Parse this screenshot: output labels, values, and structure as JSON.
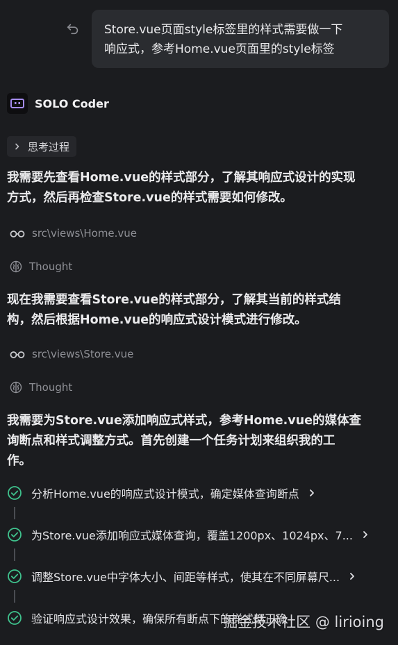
{
  "user_message": {
    "line1": "Store.vue页面style标签里的样式需要做一下",
    "line2": "响应式，参考Home.vue页面里的style标签"
  },
  "agent": {
    "name": "SOLO Coder"
  },
  "thinking": {
    "label": "思考过程"
  },
  "messages": [
    {
      "line1": "我需要先查看Home.vue的样式部分，了解其响应式设计的实现",
      "line2": "方式，然后再检查Store.vue的样式需要如何修改。"
    },
    {
      "line1": "现在我需要查看Store.vue的样式部分，了解其当前的样式结",
      "line2": "构，然后根据Home.vue的响应式设计模式进行修改。"
    },
    {
      "line1": "我需要为Store.vue添加响应式样式，参考Home.vue的媒体查",
      "line2": "询断点和样式调整方式。首先创建一个任务计划来组织我的工",
      "line3": "作。"
    }
  ],
  "file_reads": [
    "src\\views\\Home.vue",
    "src\\views\\Store.vue"
  ],
  "thought_label": "Thought",
  "tasks": [
    "分析Home.vue的响应式设计模式，确定媒体查询断点",
    "为Store.vue添加响应式媒体查询，覆盖1200px、1024px、7...",
    "调整Store.vue中字体大小、间距等样式，使其在不同屏幕尺...",
    "验证响应式设计效果，确保所有断点下的样式都正确"
  ],
  "watermark": "掘金技术社区 @ lirioing",
  "colors": {
    "background": "#1b1c1f",
    "bubble": "#2a2c30",
    "check": "#3fc28d",
    "avatar_accent": "#a58cf0"
  },
  "icons": [
    "undo-icon",
    "robot-icon",
    "chevron-right-icon",
    "glasses-icon",
    "brain-icon",
    "check-circle-icon"
  ]
}
